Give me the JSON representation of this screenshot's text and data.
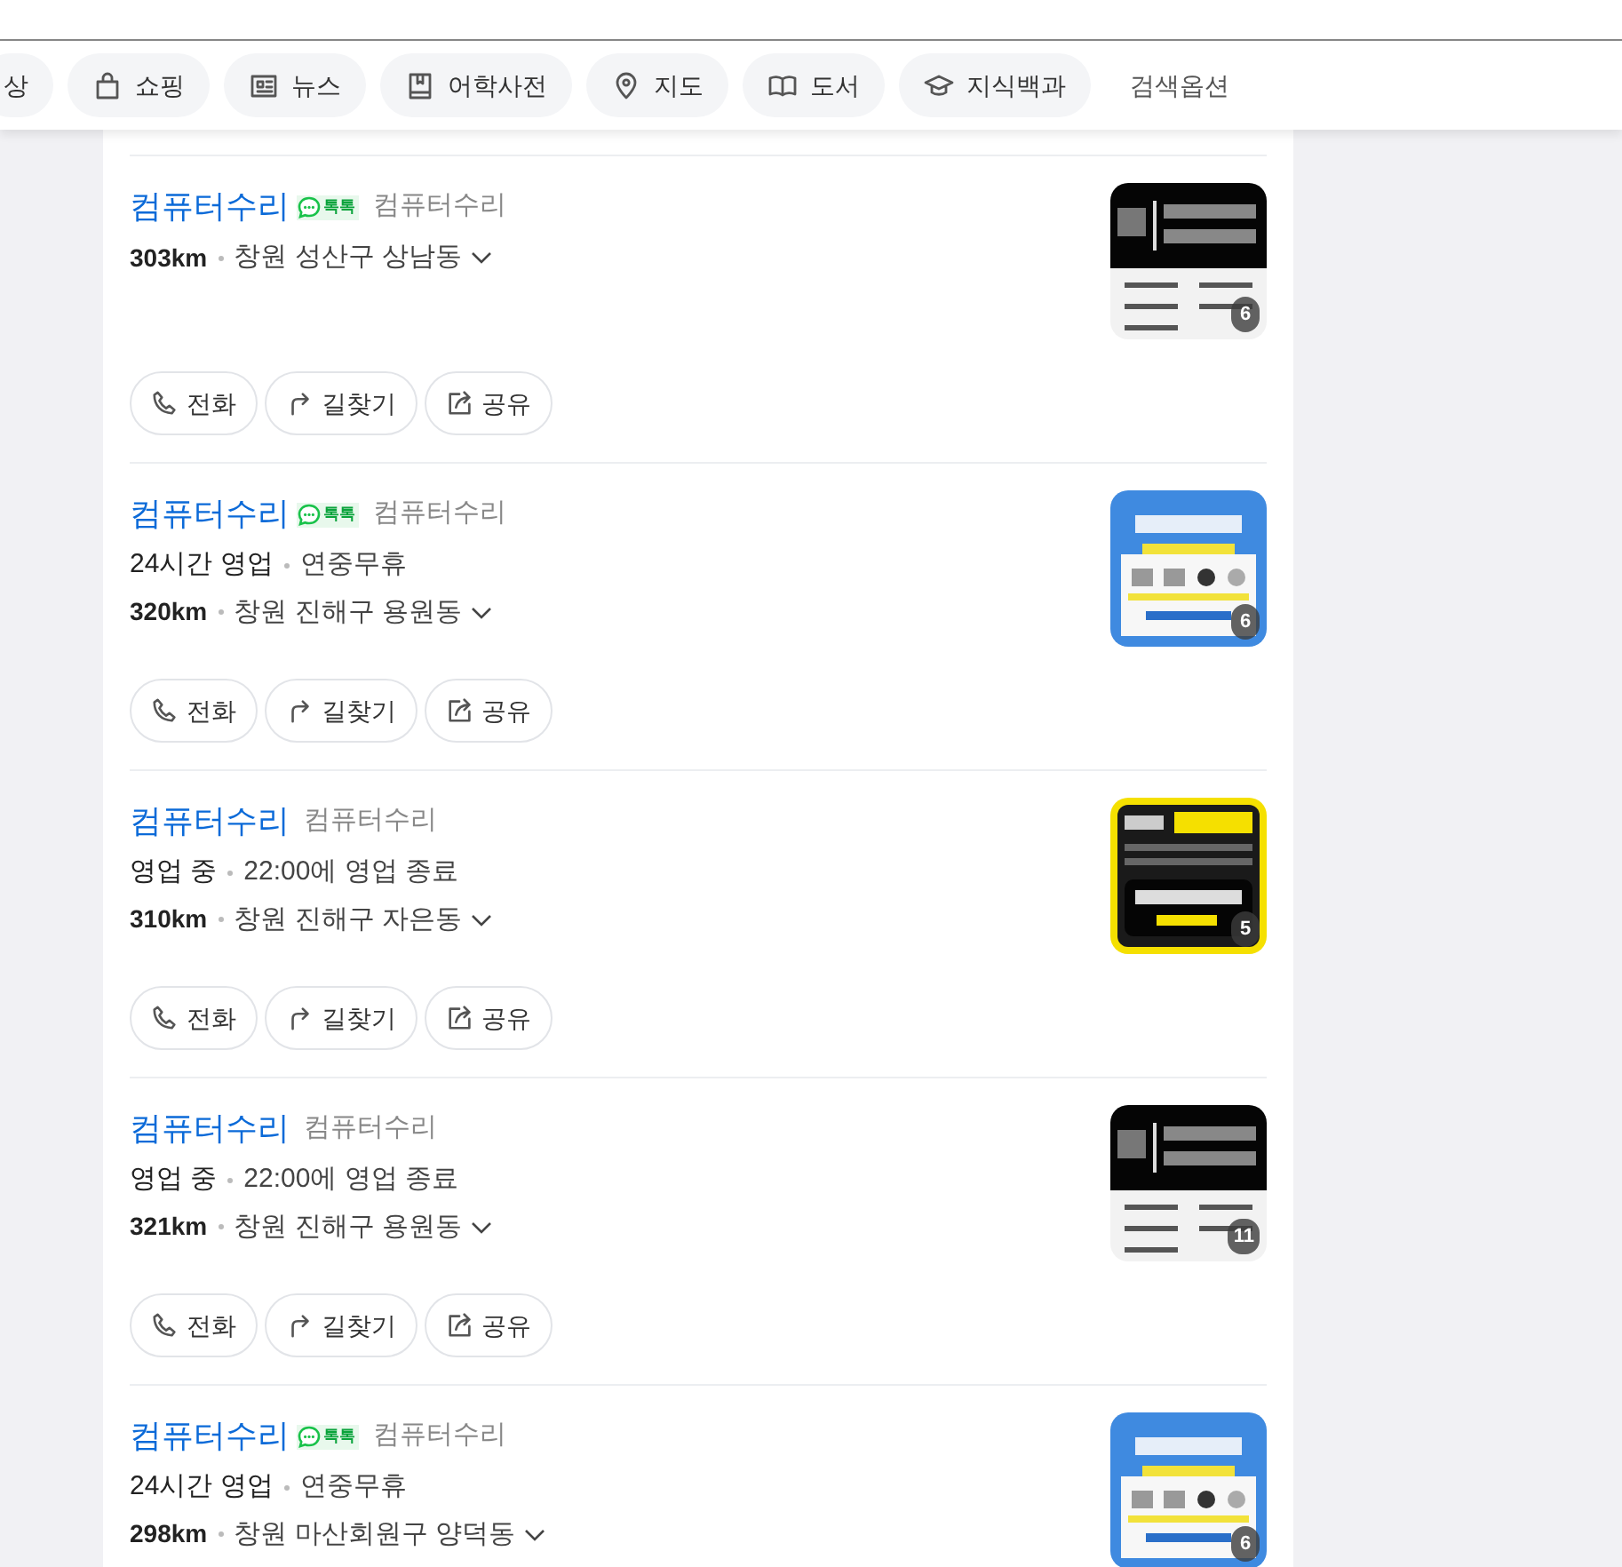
{
  "tabs": [
    {
      "label": "상",
      "kind": "chip"
    },
    {
      "label": "쇼핑",
      "kind": "chip"
    },
    {
      "label": "뉴스",
      "kind": "chip"
    },
    {
      "label": "어학사전",
      "kind": "chip"
    },
    {
      "label": "지도",
      "kind": "chip"
    },
    {
      "label": "도서",
      "kind": "chip"
    },
    {
      "label": "지식백과",
      "kind": "chip"
    },
    {
      "label": "검색옵션",
      "kind": "link"
    }
  ],
  "results": [
    {
      "name": "컴퓨터수리",
      "talk": "톡톡",
      "category": "컴퓨터수리",
      "distance": "303km",
      "address": "창원 성산구 상남동",
      "thumb": {
        "kind": "picture",
        "count": "6"
      },
      "actions": [
        "전화",
        "길찾기",
        "공유"
      ]
    },
    {
      "name": "컴퓨터수리",
      "talk": "톡톡",
      "category": "컴퓨터수리",
      "hours": {
        "status": "24시간 영업",
        "note": "연중무휴"
      },
      "distance": "320km",
      "address": "창원 진해구 용원동",
      "thumb": {
        "kind": "picture",
        "count": "6"
      },
      "actions": [
        "전화",
        "길찾기",
        "공유"
      ]
    },
    {
      "name": "컴퓨터수리",
      "category": "컴퓨터수리",
      "hours": {
        "status": "영업 중",
        "note": "22:00에 영업 종료"
      },
      "distance": "310km",
      "address": "창원 진해구 자은동",
      "thumb": {
        "kind": "picture",
        "count": "5"
      },
      "actions": [
        "전화",
        "길찾기",
        "공유"
      ]
    },
    {
      "name": "컴퓨터수리",
      "category": "컴퓨터수리",
      "hours": {
        "status": "영업 중",
        "note": "22:00에 영업 종료"
      },
      "distance": "321km",
      "address": "창원 진해구 용원동",
      "thumb": {
        "kind": "picture",
        "count": "11"
      },
      "actions": [
        "전화",
        "길찾기",
        "공유"
      ]
    },
    {
      "name": "컴퓨터수리",
      "talk": "톡톡",
      "category": "컴퓨터수리",
      "hours": {
        "status": "24시간 영업",
        "note": "연중무휴"
      },
      "distance": "298km",
      "address": "창원 마산회원구 양덕동",
      "thumb": {
        "kind": "picture",
        "count": "6"
      }
    }
  ]
}
